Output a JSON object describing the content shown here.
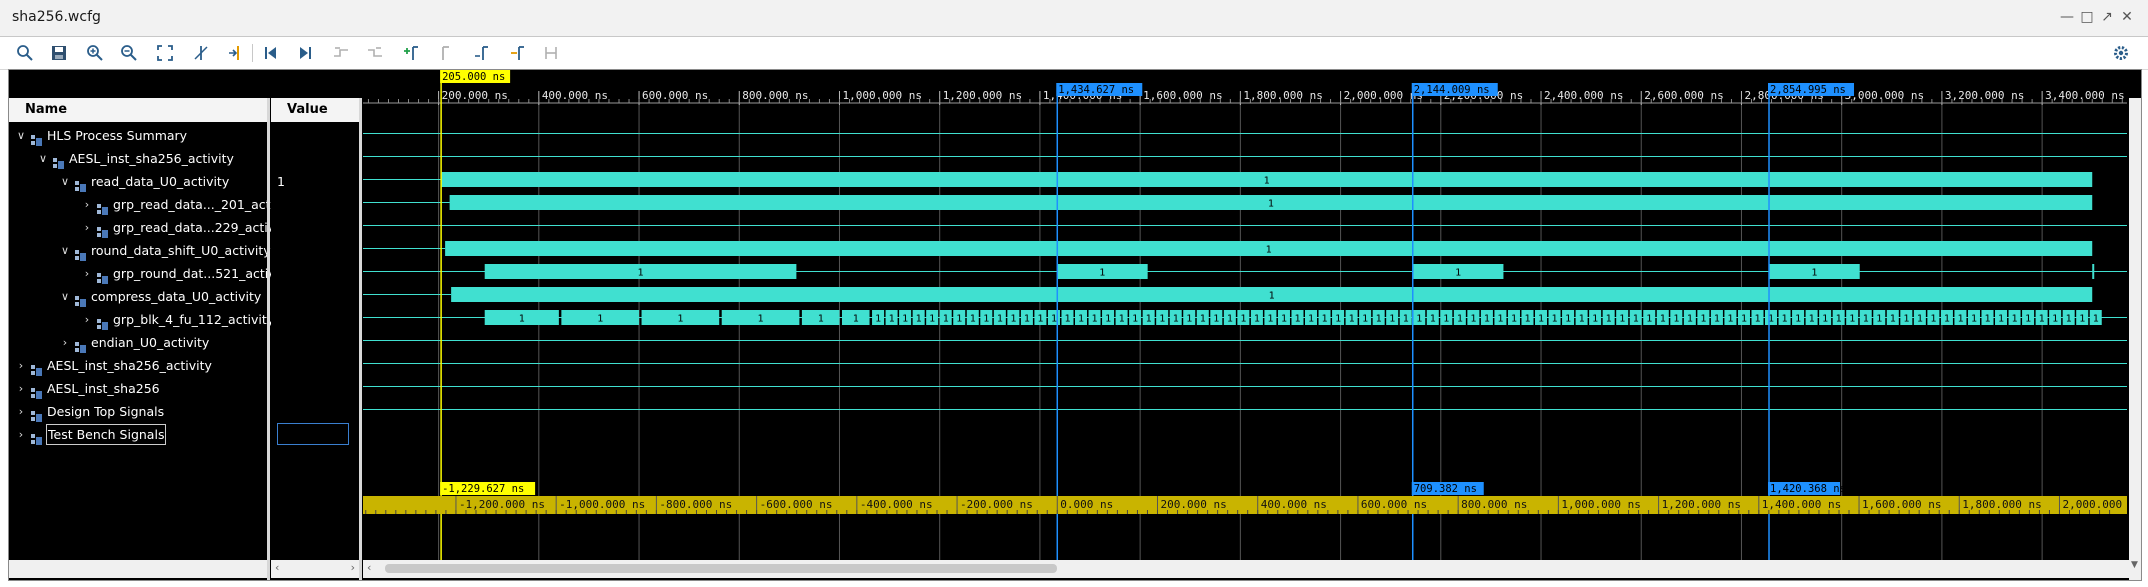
{
  "window": {
    "title": "sha256.wcfg",
    "controls": [
      "minimize-icon",
      "maximize-icon",
      "restore-icon",
      "close-icon"
    ]
  },
  "toolbar": {
    "buttons": [
      {
        "name": "search-icon"
      },
      {
        "name": "save-icon"
      },
      {
        "name": "zoom-in-icon"
      },
      {
        "name": "zoom-out-icon"
      },
      {
        "name": "zoom-fit-icon"
      },
      {
        "name": "cursor-icon"
      },
      {
        "name": "goto-cursor-icon"
      },
      {
        "name": "go-to-time-0-icon"
      },
      {
        "name": "go-to-last-time-icon"
      },
      {
        "name": "previous-transition-icon"
      },
      {
        "name": "next-transition-icon"
      },
      {
        "name": "add-marker-icon"
      },
      {
        "name": "previous-marker-icon"
      },
      {
        "name": "next-marker-icon"
      },
      {
        "name": "swap-cursors-icon"
      },
      {
        "name": "snap-to-transition-icon"
      },
      {
        "name": "settings-icon"
      }
    ]
  },
  "columns": {
    "name": "Name",
    "value": "Value"
  },
  "signals": [
    {
      "label": "HLS Process Summary",
      "indent": 0,
      "expanded": true,
      "value": ""
    },
    {
      "label": "AESL_inst_sha256_activity",
      "indent": 1,
      "expanded": true,
      "value": ""
    },
    {
      "label": "read_data_U0_activity",
      "indent": 2,
      "expanded": true,
      "value": "1"
    },
    {
      "label": "grp_read_data..._201_activi",
      "indent": 3,
      "expanded": false,
      "value": ""
    },
    {
      "label": "grp_read_data...229_activit",
      "indent": 3,
      "expanded": false,
      "value": ""
    },
    {
      "label": "round_data_shift_U0_activity",
      "indent": 2,
      "expanded": true,
      "value": ""
    },
    {
      "label": "grp_round_dat...521_activit",
      "indent": 3,
      "expanded": false,
      "value": ""
    },
    {
      "label": "compress_data_U0_activity",
      "indent": 2,
      "expanded": true,
      "value": ""
    },
    {
      "label": "grp_blk_4_fu_112_activity",
      "indent": 3,
      "expanded": false,
      "value": ""
    },
    {
      "label": "endian_U0_activity",
      "indent": 2,
      "expanded": false,
      "value": ""
    },
    {
      "label": "AESL_inst_sha256_activity",
      "indent": 0,
      "expanded": false,
      "value": ""
    },
    {
      "label": "AESL_inst_sha256",
      "indent": 0,
      "expanded": false,
      "value": ""
    },
    {
      "label": "Design Top Signals",
      "indent": 0,
      "expanded": false,
      "value": ""
    },
    {
      "label": "Test Bench Signals",
      "indent": 0,
      "expanded": false,
      "value": "",
      "selected": true
    }
  ],
  "timeline": {
    "unit": "ns",
    "top_axis": {
      "labels": [
        "200.000 ns",
        "400.000 ns",
        "600.000 ns",
        "800.000 ns",
        "1,000.000 ns",
        "1,200.000 ns",
        "1,400.000 ns",
        "1,600.000 ns",
        "1,800.000 ns",
        "2,000.000 ns",
        "2,200.000 ns",
        "2,400.000 ns",
        "2,600.000 ns",
        "2,800.000 ns",
        "3,000.000 ns",
        "3,200.000 ns",
        "3,400.000 ns"
      ],
      "values": [
        200,
        400,
        600,
        800,
        1000,
        1200,
        1400,
        1600,
        1800,
        2000,
        2200,
        2400,
        2600,
        2800,
        3000,
        3200,
        3400
      ]
    },
    "bottom_axis": {
      "labels": [
        "-1,200.000 ns",
        "-1,000.000 ns",
        "-800.000 ns",
        "-600.000 ns",
        "-400.000 ns",
        "-200.000 ns",
        "0.000 ns",
        "200.000 ns",
        "400.000 ns",
        "600.000 ns",
        "800.000 ns",
        "1,000.000 ns",
        "1,200.000 ns",
        "1,400.000 ns",
        "1,600.000 ns",
        "1,800.000 ns",
        "2,000.000 ns"
      ],
      "values": [
        -1200,
        -1000,
        -800,
        -600,
        -400,
        -200,
        0,
        200,
        400,
        600,
        800,
        1000,
        1200,
        1400,
        1600,
        1800,
        2000
      ]
    },
    "cursor": {
      "label": "205.000 ns",
      "value": 205,
      "rel_label": "-1,229.627 ns"
    },
    "markers": [
      {
        "label": "1,434.627 ns",
        "value": 1434.627,
        "rel_label": ""
      },
      {
        "label": "2,144.009 ns",
        "value": 2144.009,
        "rel_label": "709.382 ns"
      },
      {
        "label": "2,854.995 ns",
        "value": 2854.995,
        "rel_label": "1,420.368 ns"
      }
    ],
    "colors": {
      "wave": "#40e0d0",
      "cursor": "#ffff00",
      "marker": "#1e90ff",
      "grid": "#555555"
    }
  }
}
